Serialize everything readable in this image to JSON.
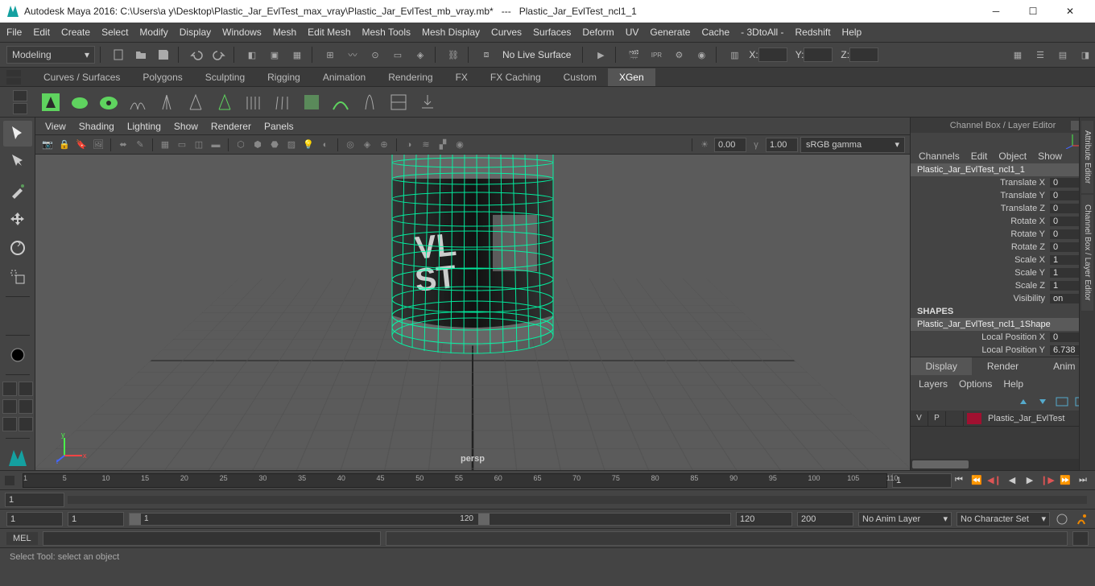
{
  "titlebar": {
    "app": "Autodesk Maya 2016:",
    "path": "C:\\Users\\a y\\Desktop\\Plastic_Jar_EvlTest_max_vray\\Plastic_Jar_EvlTest_mb_vray.mb*",
    "sep": "---",
    "scene": "Plastic_Jar_EvlTest_ncl1_1"
  },
  "menu": [
    "File",
    "Edit",
    "Create",
    "Select",
    "Modify",
    "Display",
    "Windows",
    "Mesh",
    "Edit Mesh",
    "Mesh Tools",
    "Mesh Display",
    "Curves",
    "Surfaces",
    "Deform",
    "UV",
    "Generate",
    "Cache",
    "- 3DtoAll -",
    "Redshift",
    "Help"
  ],
  "mode": "Modeling",
  "livesurface": "No Live Surface",
  "coords": {
    "x": "X:",
    "y": "Y:",
    "z": "Z:"
  },
  "shelftabs": [
    "Curves / Surfaces",
    "Polygons",
    "Sculpting",
    "Rigging",
    "Animation",
    "Rendering",
    "FX",
    "FX Caching",
    "Custom",
    "XGen"
  ],
  "shelfActive": "XGen",
  "vp_menu": [
    "View",
    "Shading",
    "Lighting",
    "Show",
    "Renderer",
    "Panels"
  ],
  "vp": {
    "val1": "0.00",
    "val2": "1.00",
    "gamma": "sRGB gamma",
    "camlabel": "persp"
  },
  "channelbox": {
    "title": "Channel Box / Layer Editor",
    "menu": [
      "Channels",
      "Edit",
      "Object",
      "Show"
    ],
    "node": "Plastic_Jar_EvlTest_ncl1_1",
    "attrs": [
      {
        "l": "Translate X",
        "v": "0"
      },
      {
        "l": "Translate Y",
        "v": "0"
      },
      {
        "l": "Translate Z",
        "v": "0"
      },
      {
        "l": "Rotate X",
        "v": "0"
      },
      {
        "l": "Rotate Y",
        "v": "0"
      },
      {
        "l": "Rotate Z",
        "v": "0"
      },
      {
        "l": "Scale X",
        "v": "1"
      },
      {
        "l": "Scale Y",
        "v": "1"
      },
      {
        "l": "Scale Z",
        "v": "1"
      },
      {
        "l": "Visibility",
        "v": "on"
      }
    ],
    "shapes_hdr": "SHAPES",
    "shape": "Plastic_Jar_EvlTest_ncl1_1Shape",
    "shape_attrs": [
      {
        "l": "Local Position X",
        "v": "0"
      },
      {
        "l": "Local Position Y",
        "v": "6.738"
      }
    ],
    "layertabs": [
      "Display",
      "Render",
      "Anim"
    ],
    "layertab_active": "Display",
    "layermenu": [
      "Layers",
      "Options",
      "Help"
    ],
    "layer": {
      "v": "V",
      "p": "P",
      "name": "Plastic_Jar_EvlTest"
    }
  },
  "vtabs": [
    "Attribute Editor",
    "Channel Box / Layer Editor"
  ],
  "timeline": {
    "start": "1",
    "cur": "1",
    "ticks": [
      1,
      5,
      10,
      15,
      20,
      25,
      30,
      35,
      40,
      45,
      50,
      55,
      60,
      65,
      70,
      75,
      80,
      85,
      90,
      95,
      100,
      105,
      110
    ],
    "end": "120"
  },
  "range": {
    "startOuter": "1",
    "startInner": "1",
    "sliderNum": "1",
    "sliderMax": "120",
    "endInner": "120",
    "endOuter": "200",
    "animlayer": "No Anim Layer",
    "charset": "No Character Set"
  },
  "cmd": {
    "lang": "MEL"
  },
  "help": "Select Tool: select an object"
}
